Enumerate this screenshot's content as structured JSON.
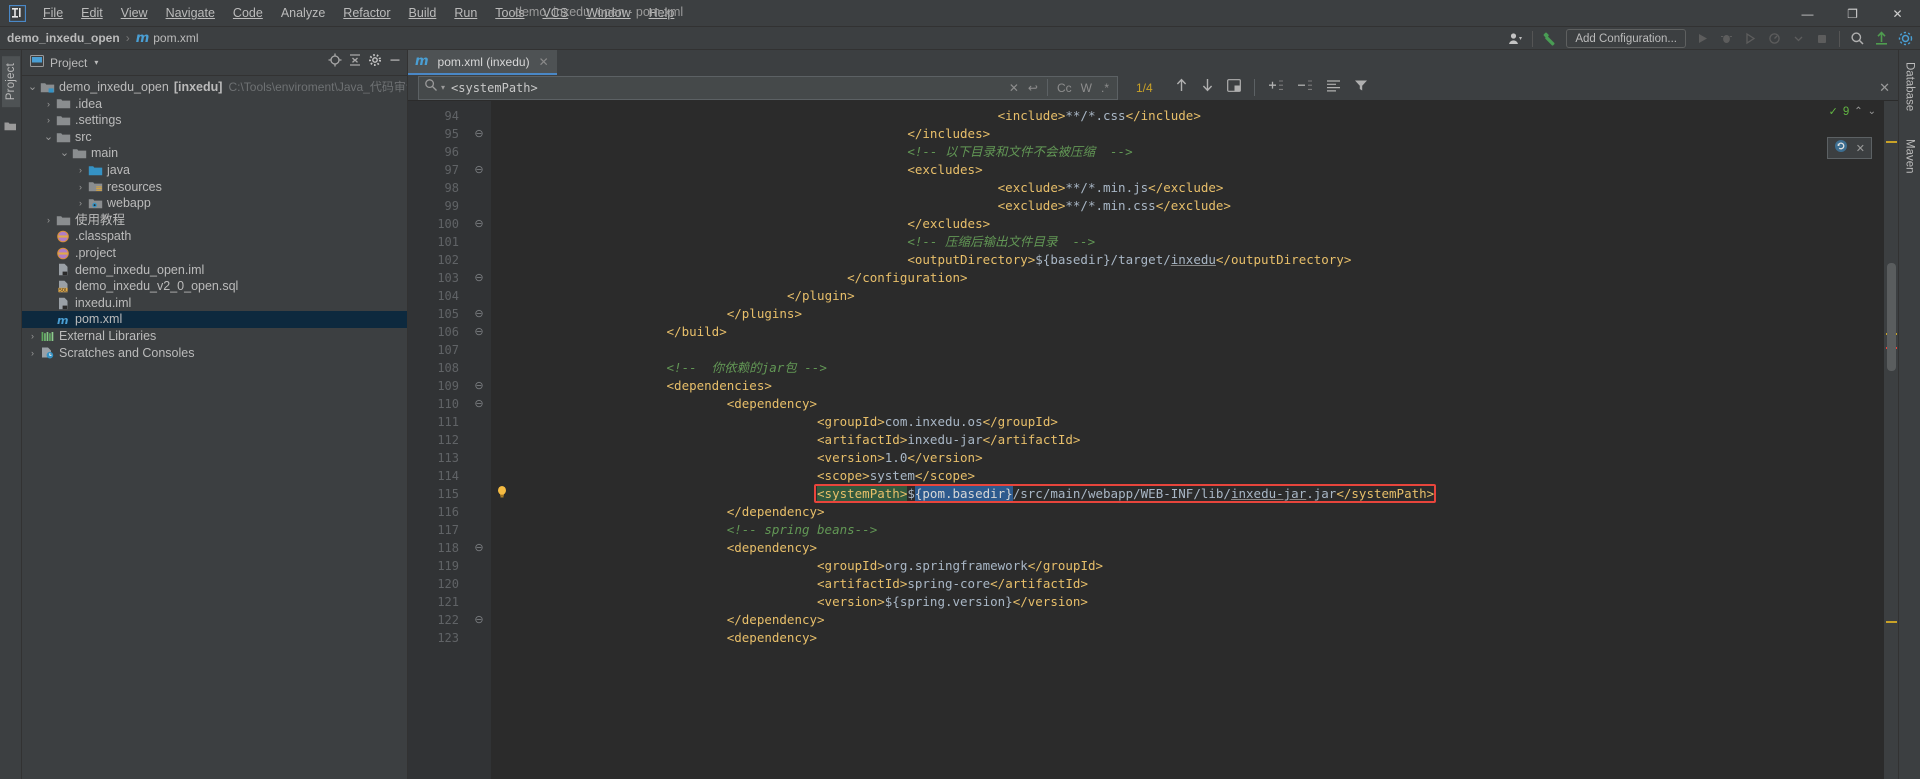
{
  "window": {
    "title": "demo_inxedu_open - pom.xml",
    "minimize": "—",
    "maximize": "❐",
    "close": "✕"
  },
  "menubar": {
    "items": [
      {
        "label": "File",
        "mn": "F"
      },
      {
        "label": "Edit",
        "mn": "E"
      },
      {
        "label": "View",
        "mn": "V"
      },
      {
        "label": "Navigate",
        "mn": "N"
      },
      {
        "label": "Code",
        "mn": "C"
      },
      {
        "label": "Analyze",
        "mn": "A"
      },
      {
        "label": "Refactor",
        "mn": "R"
      },
      {
        "label": "Build",
        "mn": "B"
      },
      {
        "label": "Run",
        "mn": "R"
      },
      {
        "label": "Tools",
        "mn": "T"
      },
      {
        "label": "VCS",
        "mn": "S"
      },
      {
        "label": "Window",
        "mn": "W"
      },
      {
        "label": "Help",
        "mn": "H"
      }
    ]
  },
  "navbar": {
    "crumb_project": "demo_inxedu_open",
    "separator": "›",
    "crumb_file": "pom.xml",
    "add_configuration": "Add Configuration...",
    "run_icon": "run-icon",
    "debug_icon": "debug-icon",
    "coverage_icon": "coverage-icon",
    "profile_icon": "profile-icon",
    "stop_icon": "stop-icon",
    "search_everywhere_icon": "search-icon",
    "update_icon": "update-project-icon",
    "settings_icon": "settings-icon",
    "user_icon": "user-account-icon",
    "hammer_icon": "build-hammer-icon"
  },
  "left_rail": {
    "project_label": "Project",
    "structure_icon": "structure-icon"
  },
  "right_rail": {
    "database_label": "Database",
    "maven_label": "Maven"
  },
  "project_panel": {
    "title": "Project",
    "caret": "▾",
    "panel_icon": "project-view-icon",
    "action_locate": "locate-icon",
    "action_collapse": "collapse-all-icon",
    "action_settings": "gear-icon",
    "action_hide": "hide-icon",
    "tree": [
      {
        "indent": 0,
        "arrow": "⌄",
        "icon": "module-folder",
        "label": "demo_inxedu_open",
        "bold_suffix": "[inxedu]",
        "path": "C:\\Tools\\enviroment\\Java_代码审计\\demo_inx",
        "selected": false
      },
      {
        "indent": 1,
        "arrow": "›",
        "icon": "folder",
        "label": ".idea",
        "selected": false
      },
      {
        "indent": 1,
        "arrow": "›",
        "icon": "folder",
        "label": ".settings",
        "selected": false
      },
      {
        "indent": 1,
        "arrow": "⌄",
        "icon": "folder",
        "label": "src",
        "selected": false
      },
      {
        "indent": 2,
        "arrow": "⌄",
        "icon": "folder",
        "label": "main",
        "selected": false
      },
      {
        "indent": 3,
        "arrow": "›",
        "icon": "source-folder",
        "label": "java",
        "selected": false
      },
      {
        "indent": 3,
        "arrow": "›",
        "icon": "resource-folder",
        "label": "resources",
        "selected": false
      },
      {
        "indent": 3,
        "arrow": "›",
        "icon": "webapp-folder",
        "label": "webapp",
        "selected": false
      },
      {
        "indent": 1,
        "arrow": "›",
        "icon": "folder",
        "label": "使用教程",
        "selected": false
      },
      {
        "indent": 1,
        "arrow": "",
        "icon": "classpath-file",
        "label": ".classpath",
        "selected": false
      },
      {
        "indent": 1,
        "arrow": "",
        "icon": "classpath-file",
        "label": ".project",
        "selected": false
      },
      {
        "indent": 1,
        "arrow": "",
        "icon": "iml-file",
        "label": "demo_inxedu_open.iml",
        "selected": false
      },
      {
        "indent": 1,
        "arrow": "",
        "icon": "sql-file",
        "label": "demo_inxedu_v2_0_open.sql",
        "selected": false
      },
      {
        "indent": 1,
        "arrow": "",
        "icon": "iml-file",
        "label": "inxedu.iml",
        "selected": false
      },
      {
        "indent": 1,
        "arrow": "",
        "icon": "maven-file",
        "label": "pom.xml",
        "selected": true
      },
      {
        "indent": 0,
        "arrow": "›",
        "icon": "libraries-icon",
        "label": "External Libraries",
        "selected": false
      },
      {
        "indent": 0,
        "arrow": "›",
        "icon": "scratches-icon",
        "label": "Scratches and Consoles",
        "selected": false
      }
    ]
  },
  "editor": {
    "tab": {
      "icon": "maven-file-icon",
      "label": "pom.xml (inxedu)",
      "close": "✕"
    },
    "find": {
      "icon": "search-icon",
      "dropdown": "▾",
      "query": "<systemPath>",
      "clear_icon": "✕",
      "history_icon": "↩",
      "match_case": "Cc",
      "words": "W",
      "regex": ".*",
      "counter": "1/4",
      "prev_icon": "↑",
      "next_icon": "↓",
      "select_all_icon": "select-all-occurrences-icon",
      "add_line_icon": "add-line-icon",
      "remove_line_icon": "remove-line-icon",
      "list_icon": "open-in-find-window-icon",
      "filter_icon": "filter-icon",
      "close_icon": "✕"
    },
    "inspection": {
      "count": "9",
      "ok_icon": "✓",
      "up": "⌃",
      "down": "⌄"
    },
    "maven_popup": {
      "icon": "maven-reload-icon",
      "close": "✕"
    },
    "first_line_number": 94,
    "lines": [
      {
        "n": 94,
        "fold": "",
        "indent": 16,
        "segs": [
          {
            "c": "tag",
            "t": "<include>"
          },
          {
            "c": "txt",
            "t": "**/*.css"
          },
          {
            "c": "tag",
            "t": "</include>"
          }
        ]
      },
      {
        "n": 95,
        "fold": "⊖",
        "indent": 13,
        "segs": [
          {
            "c": "tag",
            "t": "</includes>"
          }
        ]
      },
      {
        "n": 96,
        "fold": "",
        "indent": 13,
        "segs": [
          {
            "c": "cmt",
            "t": "<!-- 以下目录和文件不会被压缩  -->"
          }
        ]
      },
      {
        "n": 97,
        "fold": "⊖",
        "indent": 13,
        "segs": [
          {
            "c": "tag",
            "t": "<excludes>"
          }
        ]
      },
      {
        "n": 98,
        "fold": "",
        "indent": 16,
        "segs": [
          {
            "c": "tag",
            "t": "<exclude>"
          },
          {
            "c": "txt",
            "t": "**/*.min.js"
          },
          {
            "c": "tag",
            "t": "</exclude>"
          }
        ]
      },
      {
        "n": 99,
        "fold": "",
        "indent": 16,
        "segs": [
          {
            "c": "tag",
            "t": "<exclude>"
          },
          {
            "c": "txt",
            "t": "**/*.min.css"
          },
          {
            "c": "tag",
            "t": "</exclude>"
          }
        ]
      },
      {
        "n": 100,
        "fold": "⊖",
        "indent": 13,
        "segs": [
          {
            "c": "tag",
            "t": "</excludes>"
          }
        ]
      },
      {
        "n": 101,
        "fold": "",
        "indent": 13,
        "segs": [
          {
            "c": "cmt",
            "t": "<!-- 压缩后输出文件目录  -->"
          }
        ]
      },
      {
        "n": 102,
        "fold": "",
        "indent": 13,
        "segs": [
          {
            "c": "tag",
            "t": "<outputDirectory>"
          },
          {
            "c": "txt",
            "t": "${basedir}/target/"
          },
          {
            "c": "und",
            "t": "inxedu"
          },
          {
            "c": "tag",
            "t": "</outputDirectory>"
          }
        ]
      },
      {
        "n": 103,
        "fold": "⊖",
        "indent": 11,
        "segs": [
          {
            "c": "tag",
            "t": "</configuration>"
          }
        ]
      },
      {
        "n": 104,
        "fold": "",
        "indent": 9,
        "segs": [
          {
            "c": "tag",
            "t": "</plugin>"
          }
        ]
      },
      {
        "n": 105,
        "fold": "⊖",
        "indent": 7,
        "segs": [
          {
            "c": "tag",
            "t": "</plugins>"
          }
        ]
      },
      {
        "n": 106,
        "fold": "⊖",
        "indent": 5,
        "segs": [
          {
            "c": "tag",
            "t": "</build>"
          }
        ]
      },
      {
        "n": 107,
        "fold": "",
        "indent": 0,
        "segs": []
      },
      {
        "n": 108,
        "fold": "",
        "indent": 5,
        "segs": [
          {
            "c": "cmt",
            "t": "<!--  你依赖的jar包 -->"
          }
        ]
      },
      {
        "n": 109,
        "fold": "⊖",
        "indent": 5,
        "segs": [
          {
            "c": "tag",
            "t": "<dependencies>"
          }
        ]
      },
      {
        "n": 110,
        "fold": "⊖",
        "indent": 7,
        "segs": [
          {
            "c": "tag",
            "t": "<dependency>"
          }
        ]
      },
      {
        "n": 111,
        "fold": "",
        "indent": 10,
        "segs": [
          {
            "c": "tag",
            "t": "<groupId>"
          },
          {
            "c": "txt",
            "t": "com.inxedu.os"
          },
          {
            "c": "tag",
            "t": "</groupId>"
          }
        ]
      },
      {
        "n": 112,
        "fold": "",
        "indent": 10,
        "segs": [
          {
            "c": "tag",
            "t": "<artifactId>"
          },
          {
            "c": "txt",
            "t": "inxedu-jar"
          },
          {
            "c": "tag",
            "t": "</artifactId>"
          }
        ]
      },
      {
        "n": 113,
        "fold": "",
        "indent": 10,
        "segs": [
          {
            "c": "tag",
            "t": "<version>"
          },
          {
            "c": "txt",
            "t": "1.0"
          },
          {
            "c": "tag",
            "t": "</version>"
          }
        ]
      },
      {
        "n": 114,
        "fold": "",
        "indent": 10,
        "segs": [
          {
            "c": "tag",
            "t": "<scope>"
          },
          {
            "c": "txt",
            "t": "system"
          },
          {
            "c": "tag",
            "t": "</scope>"
          }
        ]
      },
      {
        "n": 115,
        "fold": "",
        "indent": 10,
        "highlighted": true,
        "bulb": true,
        "segs": [
          {
            "c": "green",
            "t": "<systemPath>"
          },
          {
            "c": "txt",
            "t": "$"
          },
          {
            "c": "blue",
            "t": "{pom.basedir}"
          },
          {
            "c": "txt",
            "t": "/src/main/webapp/WEB-INF/lib/"
          },
          {
            "c": "und",
            "t": "inxedu-jar"
          },
          {
            "c": "txt",
            "t": ".jar"
          },
          {
            "c": "tag",
            "t": "</systemPath>"
          }
        ]
      },
      {
        "n": 116,
        "fold": "",
        "indent": 7,
        "segs": [
          {
            "c": "tag",
            "t": "</dependency>"
          }
        ]
      },
      {
        "n": 117,
        "fold": "",
        "indent": 7,
        "segs": [
          {
            "c": "cmt",
            "t": "<!-- spring beans-->"
          }
        ]
      },
      {
        "n": 118,
        "fold": "⊖",
        "indent": 7,
        "segs": [
          {
            "c": "tag",
            "t": "<dependency>"
          }
        ]
      },
      {
        "n": 119,
        "fold": "",
        "indent": 10,
        "segs": [
          {
            "c": "tag",
            "t": "<groupId>"
          },
          {
            "c": "txt",
            "t": "org.springframework"
          },
          {
            "c": "tag",
            "t": "</groupId>"
          }
        ]
      },
      {
        "n": 120,
        "fold": "",
        "indent": 10,
        "segs": [
          {
            "c": "tag",
            "t": "<artifactId>"
          },
          {
            "c": "txt",
            "t": "spring-core"
          },
          {
            "c": "tag",
            "t": "</artifactId>"
          }
        ]
      },
      {
        "n": 121,
        "fold": "",
        "indent": 10,
        "segs": [
          {
            "c": "tag",
            "t": "<version>"
          },
          {
            "c": "txt",
            "t": "${spring.version}"
          },
          {
            "c": "tag",
            "t": "</version>"
          }
        ]
      },
      {
        "n": 122,
        "fold": "⊖",
        "indent": 7,
        "segs": [
          {
            "c": "tag",
            "t": "</dependency>"
          }
        ]
      },
      {
        "n": 123,
        "fold": "",
        "indent": 7,
        "segs": [
          {
            "c": "tag",
            "t": "<dependency>"
          }
        ]
      }
    ]
  },
  "colors": {
    "bg_panel": "#3c3f41",
    "bg_editor": "#2b2b2b",
    "accent_blue": "#4a88c7",
    "selection_blue": "#2d5a8e",
    "search_green": "#32593d",
    "error_red": "#e8453c",
    "tag_orange": "#e8bf6a",
    "comment_green": "#629755",
    "counter_gold": "#c9a227",
    "tree_selected": "#0d293e"
  }
}
